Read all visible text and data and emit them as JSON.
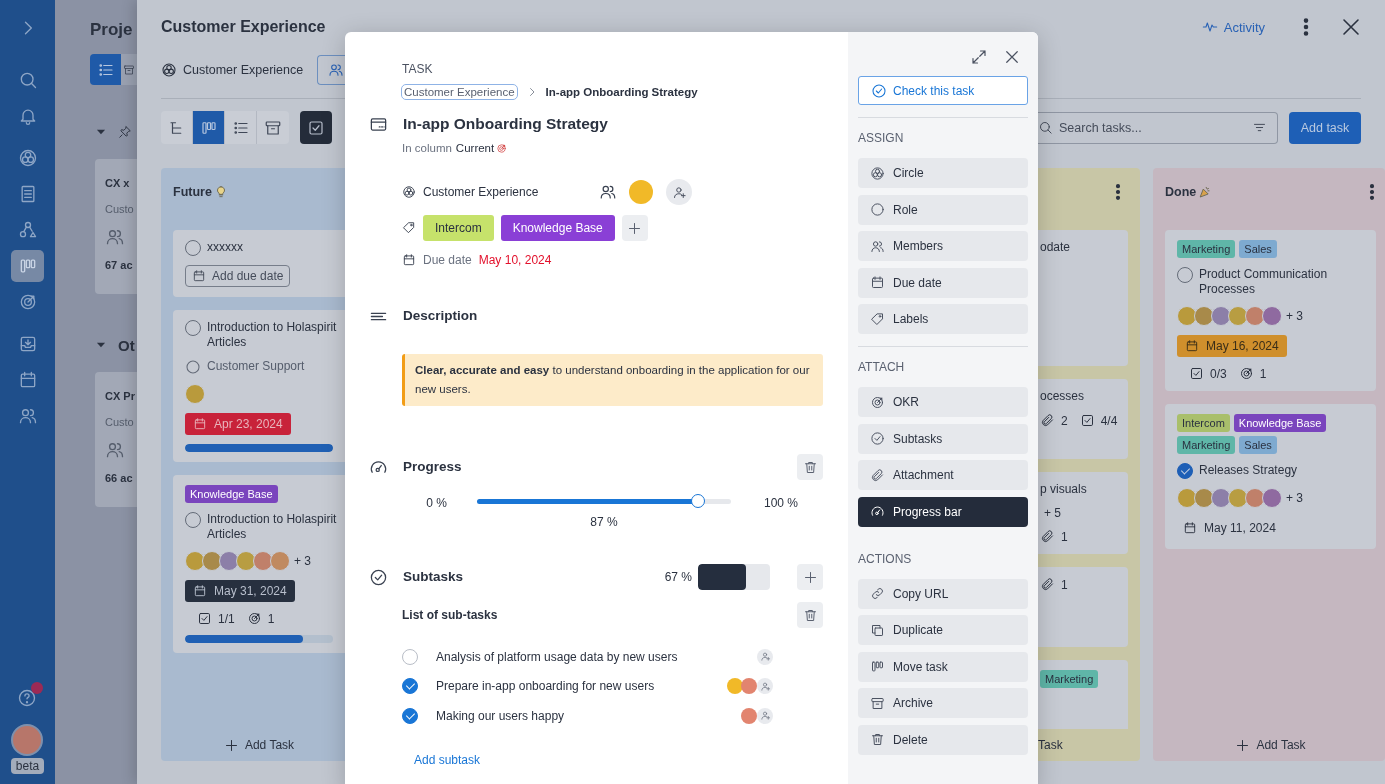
{
  "nav": {
    "items": [
      {
        "selected": false
      },
      {
        "selected": false
      },
      {
        "selected": false
      },
      {
        "selected": false
      },
      {
        "selected": false
      },
      {
        "selected": true
      },
      {
        "selected": false
      },
      {
        "selected": false
      },
      {
        "selected": false
      },
      {
        "selected": false
      }
    ],
    "help_alert": true,
    "user_badge": "beta"
  },
  "page": {
    "title": "Proje",
    "views": [
      {
        "selected": true
      },
      {
        "selected": false
      }
    ],
    "groups": [
      {
        "kind": "pinned",
        "card": {
          "title": "CX x",
          "subtitle": "Custo",
          "count": "67 ac"
        }
      },
      {
        "kind": "other",
        "label": "Ot",
        "card": {
          "title": "CX Pr",
          "subtitle": "Custo",
          "count": "66 ac"
        }
      }
    ]
  },
  "panel": {
    "title": "Customer Experience",
    "activity": "Activity",
    "circle": "Customer Experience",
    "views": [
      {
        "selected": false
      },
      {
        "selected": true
      },
      {
        "selected": false
      },
      {
        "selected": false
      }
    ],
    "search": {
      "placeholder": "Search tasks..."
    },
    "add_button": "Add task",
    "columns": [
      {
        "kind": "future",
        "title": "Future",
        "color": "#a9bacf",
        "footer": "Add Task",
        "cards": [
          {
            "title": "xxxxxx",
            "done": false,
            "due_button": "Add due date"
          },
          {
            "title": "Introduction to Holaspirit Articles",
            "done": false,
            "role": "Customer Support",
            "avatars": [
              {
                "color": "#b99a3c"
              }
            ],
            "date": {
              "text": "Apr 23, 2024",
              "kind": "overdue"
            },
            "level": 1
          },
          {
            "tags": [
              {
                "label": "Knowledge Base",
                "color": "#7a45bd"
              }
            ],
            "title": "Introduction to Holaspirit Articles",
            "done": false,
            "avatars": [
              {
                "color": "#b99a3c"
              },
              {
                "color": "#a88a4a"
              },
              {
                "color": "#8c7fa8"
              },
              {
                "color": "#b89d42"
              },
              {
                "color": "#c0806a"
              },
              {
                "color": "#c08a60"
              }
            ],
            "more": "+ 3",
            "date": {
              "text": "May 31, 2024",
              "kind": "dark"
            },
            "stats": [
              {
                "kind": "subtasks",
                "text": "1/1"
              },
              {
                "kind": "okr",
                "text": "1"
              }
            ],
            "level": 0.8
          }
        ]
      },
      {
        "kind": "partial",
        "color": "#c8c6a6",
        "footer": "Task",
        "cards": [
          {
            "title": "odate"
          },
          {
            "title": "ocesses",
            "stats": [
              {
                "kind": "attachments",
                "text": "2"
              },
              {
                "kind": "subtasks",
                "text": "4/4"
              }
            ]
          },
          {
            "title": "p visuals",
            "more": "+ 5",
            "stats": [
              {
                "kind": "attachments",
                "text": "1"
              }
            ]
          },
          {
            "stats": [
              {
                "kind": "attachments",
                "text": "1"
              }
            ]
          },
          {
            "tags": [
              {
                "label": "Marketing",
                "color": "#5fb6a8"
              }
            ]
          }
        ]
      },
      {
        "kind": "done",
        "title": "Done",
        "color": "#c5b7c0",
        "footer": "Add Task",
        "cards": [
          {
            "tags": [
              {
                "label": "Marketing",
                "color": "#5fb6a8"
              },
              {
                "label": "Sales",
                "color": "#7eaad0"
              }
            ],
            "title": "Product Communication Processes",
            "done": false,
            "avatars": [
              {
                "color": "#b99a3c"
              },
              {
                "color": "#a88a4a"
              },
              {
                "color": "#8c7fa8"
              },
              {
                "color": "#b89d42"
              },
              {
                "color": "#c0806a"
              },
              {
                "color": "#8f6aa0"
              }
            ],
            "more": "+ 3",
            "date": {
              "text": "May 16, 2024",
              "kind": "warning"
            },
            "stats": [
              {
                "kind": "subtasks",
                "text": "0/3"
              },
              {
                "kind": "okr",
                "text": "1"
              }
            ]
          },
          {
            "tags": [
              {
                "label": "Intercom",
                "color": "#a9bf6b"
              },
              {
                "label": "Knowledge Base",
                "color": "#7a45bd"
              },
              {
                "label": "Marketing",
                "color": "#5fb6a8"
              },
              {
                "label": "Sales",
                "color": "#7eaad0"
              }
            ],
            "title": "Releases Strategy",
            "done": true,
            "avatars": [
              {
                "color": "#b99a3c"
              },
              {
                "color": "#a88a4a"
              },
              {
                "color": "#8c7fa8"
              },
              {
                "color": "#b89d42"
              },
              {
                "color": "#c0806a"
              },
              {
                "color": "#8f6aa0"
              }
            ],
            "more": "+ 3",
            "date": {
              "text": "May 11, 2024",
              "kind": "plain"
            }
          }
        ]
      }
    ]
  },
  "task": {
    "label": "TASK",
    "breadcrumb": {
      "parent": "Customer Experience",
      "current": "In-app Onboarding Strategy"
    },
    "title": "In-app Onboarding Strategy",
    "column_prefix": "In column",
    "column": "Current",
    "circle": "Customer Experience",
    "members": [
      {
        "color": "#f1b928"
      }
    ],
    "tags": [
      {
        "label": "Intercom",
        "color": "#c6e26b"
      },
      {
        "label": "Knowledge Base",
        "color": "#8a3fd6"
      }
    ],
    "due_label": "Due date",
    "due_date": "May 10, 2024",
    "overdue": true,
    "description": {
      "title": "Description",
      "text": "**Clear, accurate and easy** to understand onboarding in the application for our new users."
    },
    "progress": {
      "title": "Progress",
      "min": "0 %",
      "max": "100 %",
      "value": "87 %",
      "level": 0.87
    },
    "subtasks": {
      "title": "Subtasks",
      "percent": "67 %",
      "level": 0.67,
      "list_title": "List of sub-tasks",
      "items": [
        {
          "text": "Analysis of platform usage data by new users",
          "checked": false
        },
        {
          "text": "Prepare in-app onboarding for new users",
          "checked": true,
          "avatars": [
            {
              "color": "#f1b928"
            },
            {
              "color": "#e2846f"
            }
          ]
        },
        {
          "text": "Making our users happy",
          "checked": true,
          "avatars": [
            {
              "color": "#e2846f"
            }
          ]
        }
      ],
      "add": "Add subtask"
    }
  },
  "task_sidebar": {
    "check_button": "Check this task",
    "sections": [
      {
        "title": "ASSIGN",
        "items": [
          {
            "label": "Circle",
            "active": false
          },
          {
            "label": "Role",
            "active": false
          },
          {
            "label": "Members",
            "active": false
          },
          {
            "label": "Due date",
            "active": false
          },
          {
            "label": "Labels",
            "active": false
          }
        ]
      },
      {
        "title": "ATTACH",
        "items": [
          {
            "label": "OKR",
            "active": false
          },
          {
            "label": "Subtasks",
            "active": false
          },
          {
            "label": "Attachment",
            "active": false
          },
          {
            "label": "Progress bar",
            "active": true
          }
        ]
      },
      {
        "title": "ACTIONS",
        "items": [
          {
            "label": "Copy URL",
            "active": false
          },
          {
            "label": "Duplicate",
            "active": false
          },
          {
            "label": "Move task",
            "active": false
          },
          {
            "label": "Archive",
            "active": false
          },
          {
            "label": "Delete",
            "active": false
          }
        ]
      }
    ]
  }
}
